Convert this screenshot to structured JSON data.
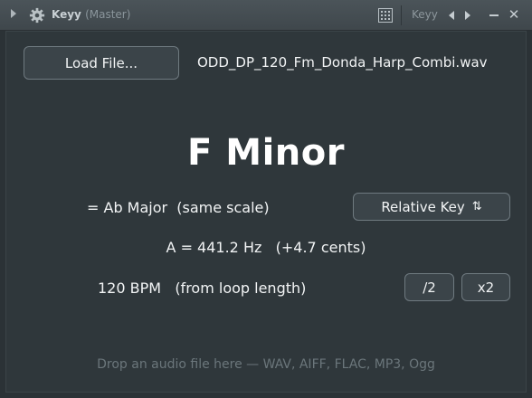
{
  "window": {
    "title": "Keyy",
    "subtitle": "(Master)",
    "plugin_name": "Keyy",
    "icons": [
      "collapse-arrow-icon",
      "gear-icon",
      "grid-icon",
      "prev-icon",
      "next-icon",
      "minimize-icon",
      "close-icon"
    ]
  },
  "file": {
    "load_label": "Load File...",
    "name": "ODD_DP_120_Fm_Donda_Harp_Combi.wav"
  },
  "analysis": {
    "key": "F Minor",
    "relative": "= Ab Major  (same scale)",
    "relative_button": "Relative Key",
    "relative_button_icon": "⇅",
    "tuning": "A = 441.2 Hz   (+4.7 cents)",
    "tempo": "120 BPM   (from loop length)",
    "half_label": "/2",
    "double_label": "x2"
  },
  "hint": "Drop an audio file here — WAV, AIFF, FLAC, MP3, Ogg",
  "colors": {
    "background": "#2b3236",
    "panel": "#2f373b",
    "button": "#3b4449",
    "button_border": "#6f7a80",
    "text": "#f2f4f5",
    "hint_text": "#6b767b"
  }
}
